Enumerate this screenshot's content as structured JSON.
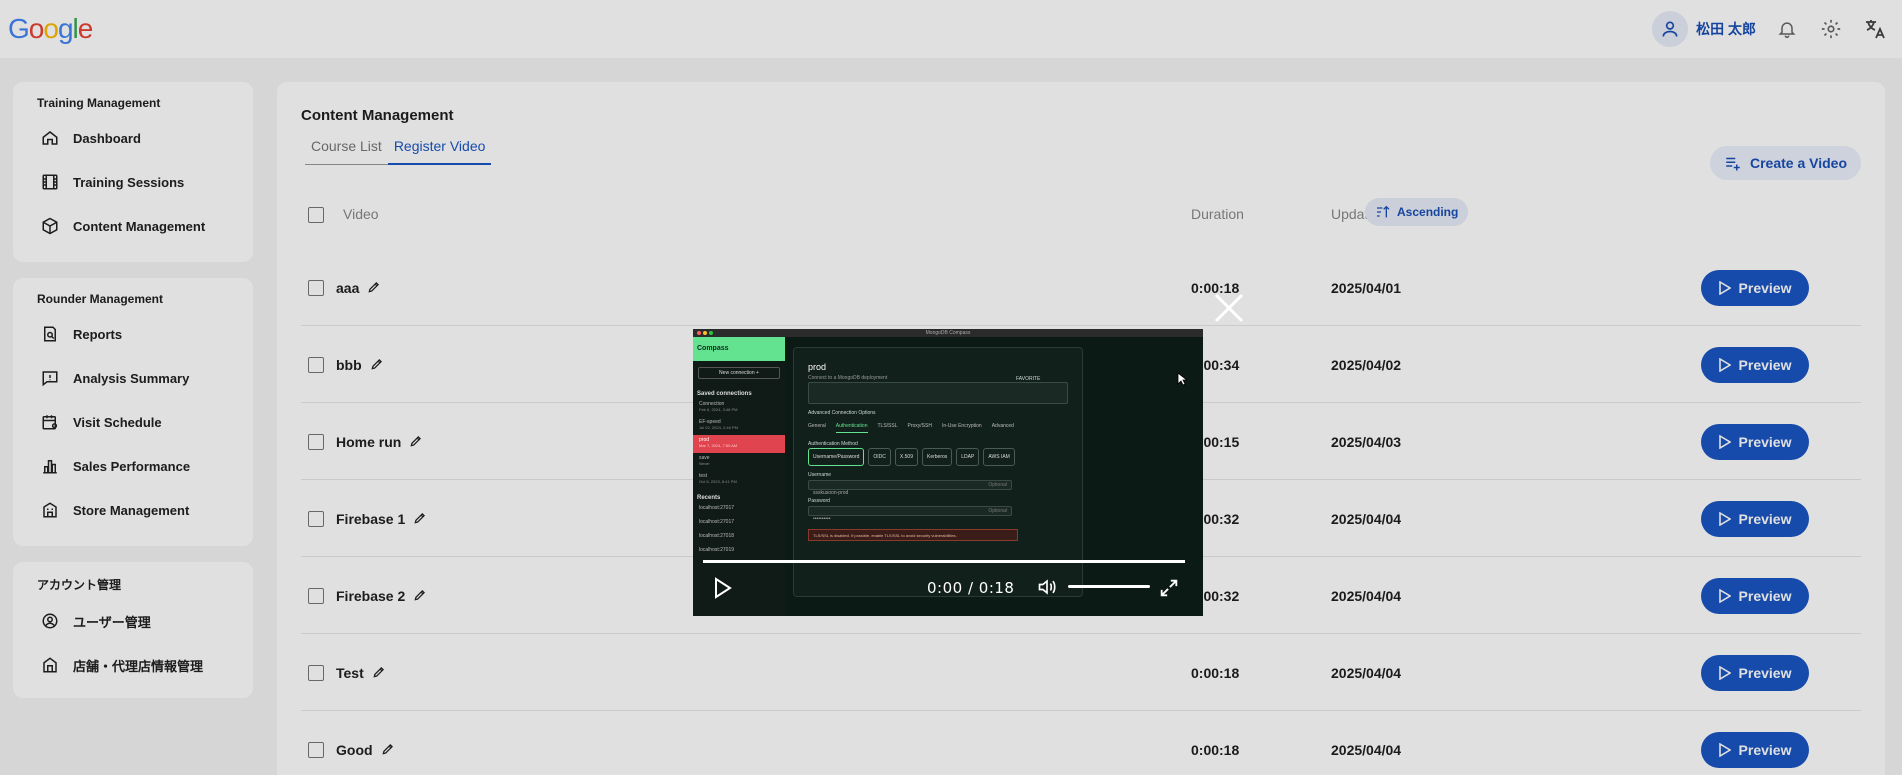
{
  "header": {
    "logo": [
      "G",
      "o",
      "o",
      "g",
      "l",
      "e"
    ],
    "logo_colors": [
      "#4285F4",
      "#EA4335",
      "#FBBC05",
      "#4285F4",
      "#34A853",
      "#EA4335"
    ],
    "user_name": "松田 太郎"
  },
  "sidebar": {
    "groups": [
      {
        "heading": "Training Management",
        "items": [
          {
            "label": "Dashboard",
            "icon": "home-icon"
          },
          {
            "label": "Training Sessions",
            "icon": "film-icon"
          },
          {
            "label": "Content Management",
            "icon": "cube-icon"
          }
        ]
      },
      {
        "heading": "Rounder Management",
        "items": [
          {
            "label": "Reports",
            "icon": "report-icon"
          },
          {
            "label": "Analysis Summary",
            "icon": "alert-message-icon"
          },
          {
            "label": "Visit Schedule",
            "icon": "calendar-user-icon"
          },
          {
            "label": "Sales Performance",
            "icon": "bar-chart-icon"
          },
          {
            "label": "Store Management",
            "icon": "store-icon"
          }
        ]
      },
      {
        "heading": "アカウント管理",
        "items": [
          {
            "label": "ユーザー管理",
            "icon": "user-circle-icon"
          },
          {
            "label": "店舗・代理店情報管理",
            "icon": "shop-icon"
          }
        ]
      }
    ]
  },
  "main": {
    "title": "Content Management",
    "tabs": [
      {
        "label": "Course List",
        "active": false
      },
      {
        "label": "Register Video",
        "active": true
      }
    ],
    "create_button": "Create a Video",
    "columns": {
      "video": "Video",
      "duration": "Duration",
      "updated": "Updated"
    },
    "sort_label": "Ascending",
    "preview_label": "Preview",
    "rows": [
      {
        "name": "aaa",
        "duration": "0:00:18",
        "updated": "2025/04/01"
      },
      {
        "name": "bbb",
        "duration": "0:00:34",
        "updated": "2025/04/02"
      },
      {
        "name": "Home run",
        "duration": "0:00:15",
        "updated": "2025/04/03"
      },
      {
        "name": "Firebase 1",
        "duration": "0:00:32",
        "updated": "2025/04/04"
      },
      {
        "name": "Firebase 2",
        "duration": "0:00:32",
        "updated": "2025/04/04"
      },
      {
        "name": "Test",
        "duration": "0:00:18",
        "updated": "2025/04/04"
      },
      {
        "name": "Good",
        "duration": "0:00:18",
        "updated": "2025/04/04"
      }
    ]
  },
  "player": {
    "time": "0:00 / 0:18",
    "progress": 0,
    "volume": 1,
    "frame": {
      "window_title": "MongoDB Compass",
      "app_name": "Compass",
      "new_connection": "New connection +",
      "saved_heading": "Saved connections",
      "saved": [
        {
          "name": "Connection",
          "date": "Feb 6, 2024, 3:48 PM"
        },
        {
          "name": "EF-speed",
          "date": "Jul 02, 2024, 2:46 PM"
        },
        {
          "name": "prod",
          "date": "Mar 7, 2024, 7:50 AM",
          "selected": true
        },
        {
          "name": "save",
          "date": "Never"
        },
        {
          "name": "test",
          "date": "Oct 8, 2023, 8:41 PM"
        }
      ],
      "recents_heading": "Recents",
      "recents": [
        "localhost:27017",
        "localhost:27017",
        "localhost:27018",
        "localhost:27019"
      ],
      "conn_name": "prod",
      "conn_sub": "Connect to a MongoDB deployment",
      "favorite": "FAVORITE",
      "advanced": "Advanced Connection Options",
      "tabs": [
        "General",
        "Authentication",
        "TLS/SSL",
        "Proxy/SSH",
        "In-Use Encryption",
        "Advanced"
      ],
      "auth_method_label": "Authentication Method",
      "auth_methods": [
        "Username/Password",
        "OIDC",
        "X.509",
        "Kerberos",
        "LDAP",
        "AWS IAM"
      ],
      "username_label": "Username",
      "username_value": "ssskusoon-prod",
      "password_label": "Password",
      "password_value": "••••••••••",
      "optional": "Optional",
      "warning": "TLS/SSL is disabled. If possible, enable TLS/SSL to avoid security vulnerabilities."
    }
  },
  "colors": {
    "primary": "#1a56c4",
    "accent_bg": "#eaf0fb",
    "compass_green": "#63e38f",
    "selected_red": "#e0454f"
  }
}
